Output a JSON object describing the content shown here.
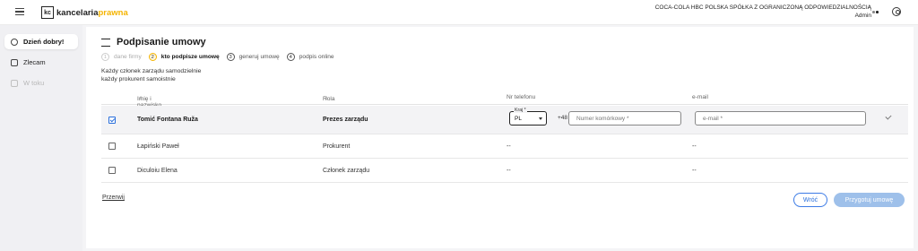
{
  "topbar": {
    "logo_mark": "kc",
    "logo_text_main": "kancelaria",
    "logo_text_accent": "prawna",
    "company_name": "COCA-COLA HBC POLSKA SPÓŁKA Z OGRANICZONĄ ODPOWIEDZIALNOŚCIĄ",
    "user_role": "Admin"
  },
  "sidebar": {
    "items": [
      {
        "label": "Dzień dobry!"
      },
      {
        "label": "Zlecam"
      },
      {
        "label": "W toku"
      }
    ]
  },
  "page": {
    "title": "Podpisanie umowy"
  },
  "steps": [
    {
      "num": "1",
      "label": "dane firmy",
      "state": "done"
    },
    {
      "num": "2",
      "label": "kto podpisze umowę",
      "state": "current"
    },
    {
      "num": "3",
      "label": "generuj umowę",
      "state": "upcoming"
    },
    {
      "num": "4",
      "label": "podpis online",
      "state": "upcoming"
    }
  ],
  "info": {
    "line1": "Każdy członek zarządu samodzielnie",
    "line2": "każdy prokurent samoistnie"
  },
  "table": {
    "headers": {
      "name": "Imię i nazwisko",
      "role": "Rola",
      "phone": "Nr telefonu",
      "email": "e-mail"
    },
    "sort_symbol": "⇕",
    "rows": [
      {
        "name": "Tomić Fontana Ruža",
        "role": "Prezes zarządu",
        "checked": true
      },
      {
        "name": "Łapiński Paweł",
        "role": "Prokurent",
        "phone": "--",
        "email": "--",
        "checked": false
      },
      {
        "name": "Diculoiu Elena",
        "role": "Członek zarządu",
        "phone": "--",
        "email": "--",
        "checked": false
      }
    ],
    "edit": {
      "country_label": "Kraj *",
      "country_value": "PL",
      "phone_prefix": "+48",
      "phone_placeholder": "Numer komórkowy *",
      "email_placeholder": "e-mail *"
    }
  },
  "actions": {
    "cancel": "Przerwij",
    "back": "Wróć",
    "next": "Przygotuj umowę"
  },
  "colors": {
    "accent_yellow": "#f5b400",
    "primary_blue": "#2a6fdb",
    "disabled_button": "#9ec0ea"
  }
}
